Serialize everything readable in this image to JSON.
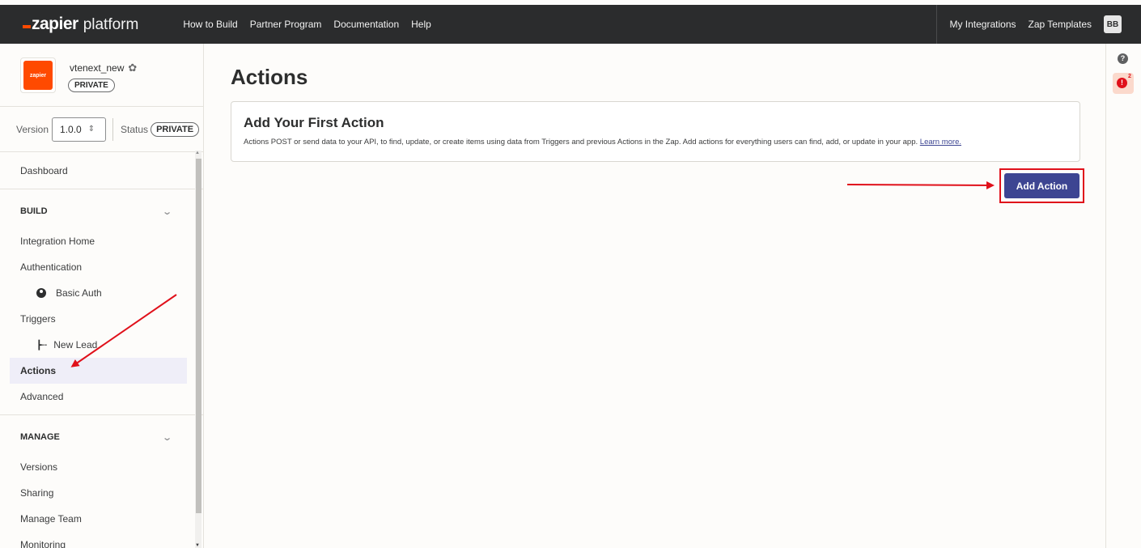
{
  "topbar": {
    "logo_word": "zapier",
    "logo_suffix": "platform",
    "nav": [
      "How to Build",
      "Partner Program",
      "Documentation",
      "Help"
    ],
    "right_links": [
      "My Integrations",
      "Zap Templates"
    ],
    "avatar": "BB"
  },
  "app": {
    "logo_text": "zapier",
    "name": "vtenext_new",
    "visibility": "PRIVATE"
  },
  "version_row": {
    "version_label": "Version",
    "version_value": "1.0.0",
    "status_label": "Status",
    "status_value": "PRIVATE"
  },
  "sidebar": {
    "dashboard": "Dashboard",
    "build_heading": "BUILD",
    "integration_home": "Integration Home",
    "authentication": "Authentication",
    "basic_auth": "Basic Auth",
    "triggers": "Triggers",
    "new_lead": "New Lead",
    "actions": "Actions",
    "advanced": "Advanced",
    "manage_heading": "MANAGE",
    "versions": "Versions",
    "sharing": "Sharing",
    "manage_team": "Manage Team",
    "monitoring": "Monitoring"
  },
  "main": {
    "title": "Actions",
    "card_title": "Add Your First Action",
    "card_text": "Actions POST or send data to your API, to find, update, or create items using data from Triggers and previous Actions in the Zap. Add actions for everything users can find, add, or update in your app.",
    "learn_more": "Learn more.",
    "add_button": "Add Action"
  },
  "rail": {
    "help_glyph": "?",
    "alert_glyph": "!",
    "alert_count": "2"
  },
  "colors": {
    "topbar_bg": "#2b2c2d",
    "brand_orange": "#ff4a00",
    "primary_button": "#3d4592",
    "annotation_red": "#e0101a"
  }
}
